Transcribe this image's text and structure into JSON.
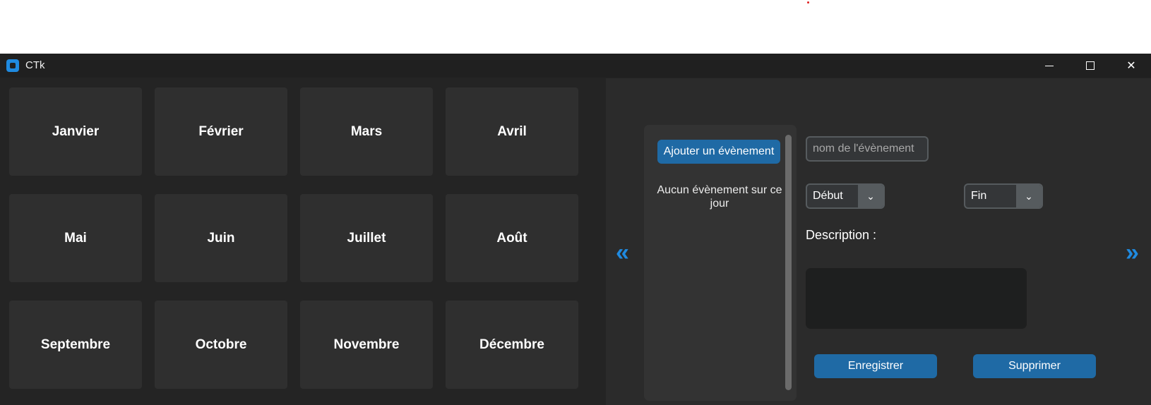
{
  "window": {
    "title": "CTk",
    "controls": {
      "minimize_icon": "minimize-icon",
      "maximize_icon": "maximize-icon",
      "close_icon": "close-icon",
      "close_glyph": "✕"
    }
  },
  "months": [
    "Janvier",
    "Février",
    "Mars",
    "Avril",
    "Mai",
    "Juin",
    "Juillet",
    "Août",
    "Septembre",
    "Octobre",
    "Novembre",
    "Décembre"
  ],
  "navigation": {
    "prev": "«",
    "next": "»"
  },
  "event_list": {
    "add_button": "Ajouter un évènement",
    "empty_message": "Aucun évènement sur ce jour"
  },
  "form": {
    "name_placeholder": "nom de l'évènement",
    "start_dropdown": {
      "value": "Début",
      "arrow": "⌄"
    },
    "end_dropdown": {
      "value": "Fin",
      "arrow": "⌄"
    },
    "description_label": "Description :",
    "save_button": "Enregistrer",
    "delete_button": "Supprimer"
  },
  "colors": {
    "accent": "#1f6aa5",
    "arrow_blue": "#1f8ae0",
    "background": "#242424",
    "panel": "#2b2b2b",
    "month_tile": "#2f2f2f"
  }
}
